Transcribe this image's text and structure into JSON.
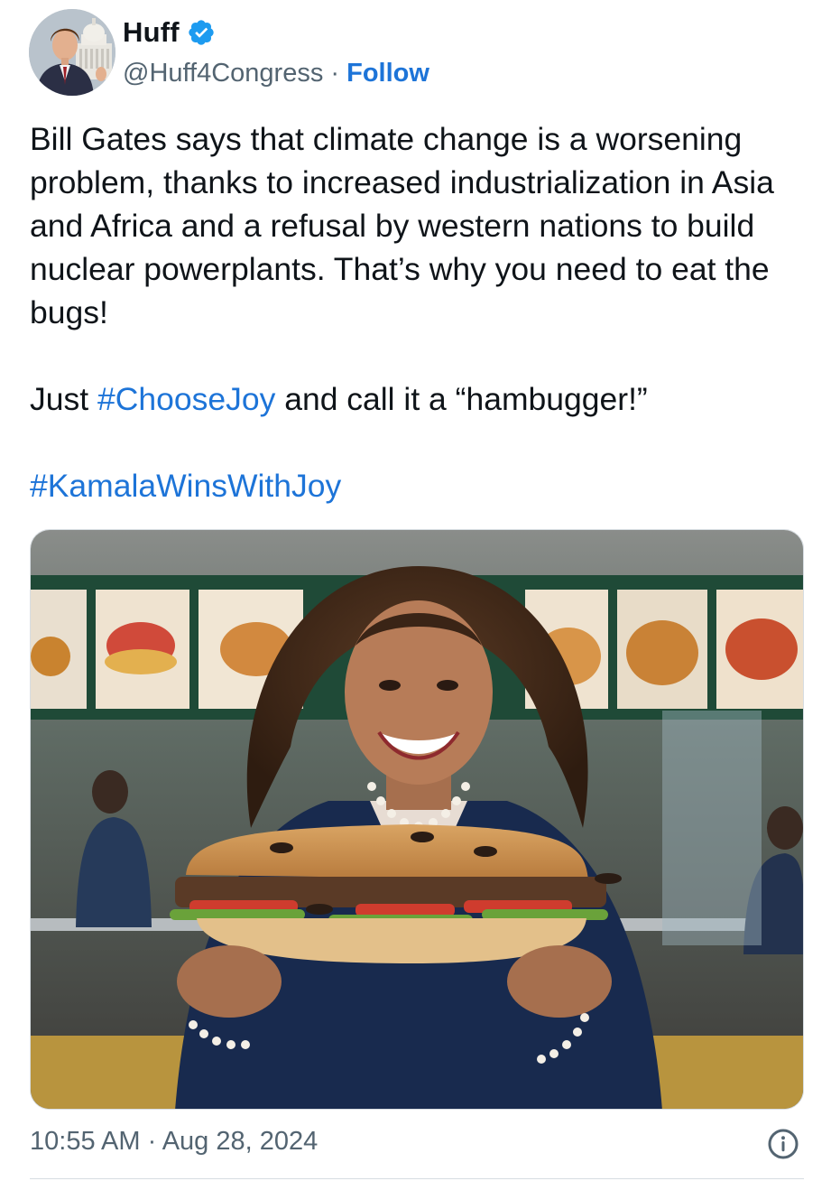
{
  "tweet": {
    "author": {
      "display_name": "Huff",
      "handle": "@Huff4Congress",
      "separator": " · ",
      "follow_label": "Follow",
      "verified": true
    },
    "text": {
      "line1": "Bill Gates says that climate change is a worsening problem, thanks to increased industrialization in Asia and Africa and a refusal by western nations to build nuclear powerplants. That’s why you need to eat the bugs!",
      "line2_prefix": "Just ",
      "line2_hashtag": "#ChooseJoy",
      "line2_suffix": " and call it a “hambugger!”",
      "line3_hashtag": "#KamalaWinsWithJoy"
    },
    "media": {
      "icon": "photo"
    },
    "timestamp": {
      "time": "10:55 AM",
      "separator": " · ",
      "date": "Aug 28, 2024"
    },
    "info_icon": "info-circle-icon"
  },
  "colors": {
    "link": "#1d74d8",
    "text": "#0f1419",
    "secondary": "#536471",
    "verified_badge": "#1d9bf0"
  }
}
